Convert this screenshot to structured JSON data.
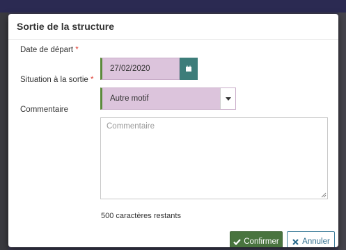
{
  "modal": {
    "title": "Sortie de la structure"
  },
  "form": {
    "date_label": "Date de départ",
    "date_required": "*",
    "date_value": "27/02/2020",
    "situation_label": "Situation à la sortie",
    "situation_required": "*",
    "situation_value": "Autre motif",
    "comment_label": "Commentaire",
    "comment_placeholder": "Commentaire",
    "chars_left": "500 caractères restants"
  },
  "actions": {
    "confirm_label": "Confirmer",
    "cancel_label": "Annuler"
  },
  "colors": {
    "required_mark": "#e0443a",
    "filled_field_bg": "#dcc4dc",
    "valid_border": "#5a8a3a",
    "calendar_button": "#3d7d7a",
    "confirm_button": "#49743f",
    "cancel_button_text": "#2e6d8e"
  },
  "icons": {
    "calendar": "calendar-icon",
    "dropdown": "chevron-down-icon",
    "confirm": "check-icon",
    "cancel": "close-icon",
    "resize": "resize-grip-icon"
  }
}
